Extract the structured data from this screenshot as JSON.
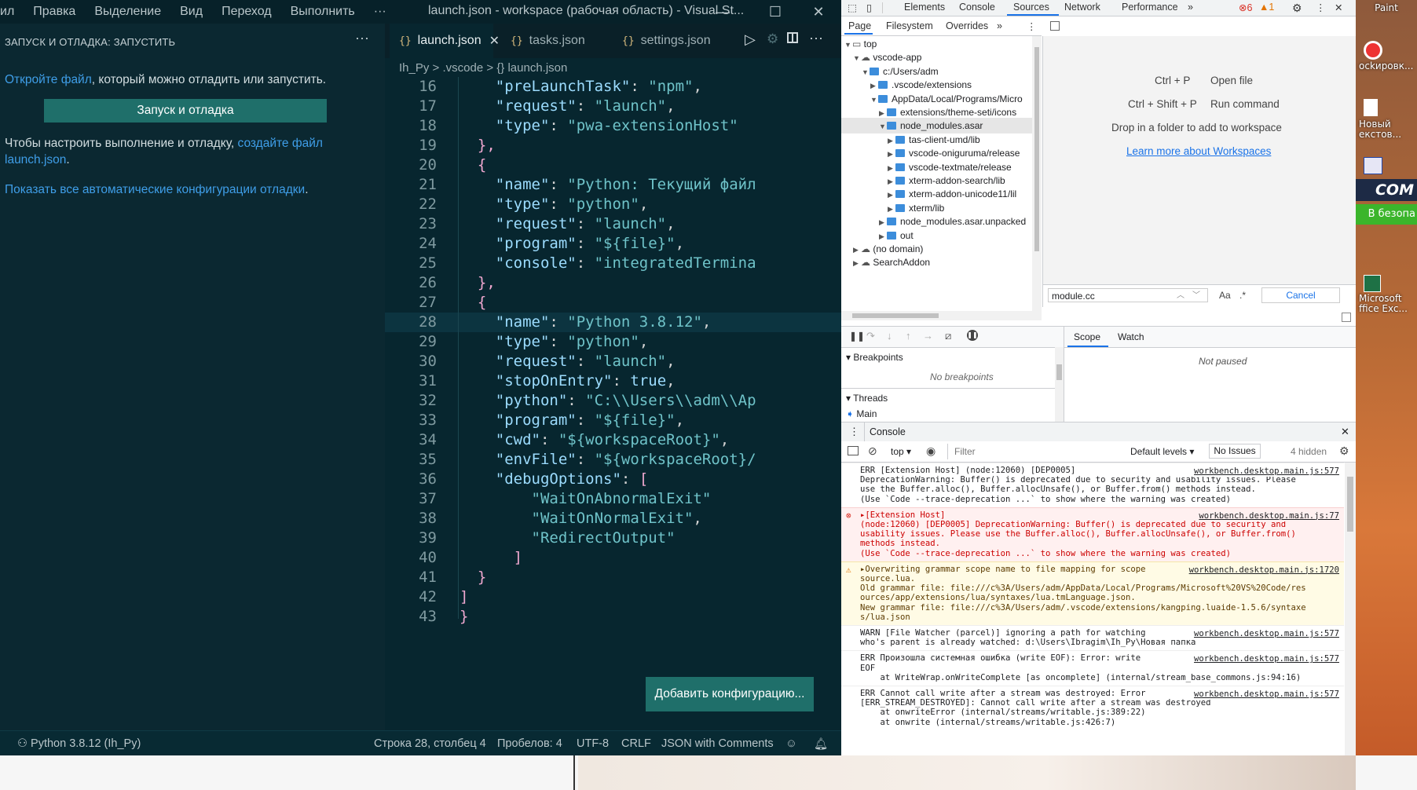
{
  "vscode": {
    "menu": [
      "ил",
      "Правка",
      "Выделение",
      "Вид",
      "Переход",
      "Выполнить",
      "···"
    ],
    "window_title": "launch.json - workspace (рабочая область) - Visual St...",
    "sidebar": {
      "title": "ЗАПУСК И ОТЛАДКА: ЗАПУСТИТЬ",
      "open_file_link": "Откройте файл",
      "open_file_text": ", который можно отладить или запустить.",
      "run_button": "Запуск и отладка",
      "configure_text": "Чтобы настроить выполнение и отладку, ",
      "configure_link": "создайте файл launch.json",
      "show_all_link": "Показать все автоматические конфигурации отладки",
      "period": "."
    },
    "tabs": [
      {
        "label": "launch.json",
        "active": true
      },
      {
        "label": "tasks.json",
        "active": false
      },
      {
        "label": "settings.json",
        "active": false
      }
    ],
    "breadcrumb": [
      "Ih_Py",
      ">",
      ".vscode",
      ">",
      "{} launch.json"
    ],
    "code_lines": [
      {
        "n": "16",
        "indent": "    ",
        "key": "\"preLaunchTask\"",
        "sep": ": ",
        "val": "\"npm\"",
        "tail": ","
      },
      {
        "n": "17",
        "indent": "    ",
        "key": "\"request\"",
        "sep": ": ",
        "val": "\"launch\"",
        "tail": ","
      },
      {
        "n": "18",
        "indent": "    ",
        "key": "\"type\"",
        "sep": ": ",
        "val": "\"pwa-extensionHost\"",
        "tail": ""
      },
      {
        "n": "19",
        "indent": "  ",
        "key": "",
        "sep": "",
        "val": "",
        "tail": "},"
      },
      {
        "n": "20",
        "indent": "  ",
        "key": "",
        "sep": "",
        "val": "",
        "tail": "{"
      },
      {
        "n": "21",
        "indent": "    ",
        "key": "\"name\"",
        "sep": ": ",
        "val": "\"Python: Текущий файл",
        "tail": ""
      },
      {
        "n": "22",
        "indent": "    ",
        "key": "\"type\"",
        "sep": ": ",
        "val": "\"python\"",
        "tail": ","
      },
      {
        "n": "23",
        "indent": "    ",
        "key": "\"request\"",
        "sep": ": ",
        "val": "\"launch\"",
        "tail": ","
      },
      {
        "n": "24",
        "indent": "    ",
        "key": "\"program\"",
        "sep": ": ",
        "val": "\"${file}\"",
        "tail": ","
      },
      {
        "n": "25",
        "indent": "    ",
        "key": "\"console\"",
        "sep": ": ",
        "val": "\"integratedTermina",
        "tail": ""
      },
      {
        "n": "26",
        "indent": "  ",
        "key": "",
        "sep": "",
        "val": "",
        "tail": "},"
      },
      {
        "n": "27",
        "indent": "  ",
        "key": "",
        "sep": "",
        "val": "",
        "tail": "{"
      },
      {
        "n": "28",
        "indent": "    ",
        "key": "\"name\"",
        "sep": ": ",
        "val": "\"Python 3.8.12\"",
        "tail": ","
      },
      {
        "n": "29",
        "indent": "    ",
        "key": "\"type\"",
        "sep": ": ",
        "val": "\"python\"",
        "tail": ","
      },
      {
        "n": "30",
        "indent": "    ",
        "key": "\"request\"",
        "sep": ": ",
        "val": "\"launch\"",
        "tail": ","
      },
      {
        "n": "31",
        "indent": "    ",
        "key": "\"stopOnEntry\"",
        "sep": ": ",
        "val": "true",
        "tail": ","
      },
      {
        "n": "32",
        "indent": "    ",
        "key": "\"python\"",
        "sep": ": ",
        "val": "\"C:\\\\Users\\\\adm\\\\Ap",
        "tail": ""
      },
      {
        "n": "33",
        "indent": "    ",
        "key": "\"program\"",
        "sep": ": ",
        "val": "\"${file}\"",
        "tail": ","
      },
      {
        "n": "34",
        "indent": "    ",
        "key": "\"cwd\"",
        "sep": ": ",
        "val": "\"${workspaceRoot}\"",
        "tail": ","
      },
      {
        "n": "35",
        "indent": "    ",
        "key": "\"envFile\"",
        "sep": ": ",
        "val": "\"${workspaceRoot}/",
        "tail": ""
      },
      {
        "n": "36",
        "indent": "    ",
        "key": "\"debugOptions\"",
        "sep": ": ",
        "val": "",
        "tail": "["
      },
      {
        "n": "37",
        "indent": "        ",
        "key": "",
        "sep": "",
        "val": "\"WaitOnAbnormalExit\"",
        "tail": ""
      },
      {
        "n": "38",
        "indent": "        ",
        "key": "",
        "sep": "",
        "val": "\"WaitOnNormalExit\"",
        "tail": ","
      },
      {
        "n": "39",
        "indent": "        ",
        "key": "",
        "sep": "",
        "val": "\"RedirectOutput\"",
        "tail": ""
      },
      {
        "n": "40",
        "indent": "      ",
        "key": "",
        "sep": "",
        "val": "",
        "tail": "]"
      },
      {
        "n": "41",
        "indent": "  ",
        "key": "",
        "sep": "",
        "val": "",
        "tail": "}"
      },
      {
        "n": "42",
        "indent": "",
        "key": "",
        "sep": "",
        "val": "",
        "tail": "]"
      },
      {
        "n": "43",
        "indent": "",
        "key": "",
        "sep": "",
        "val": "",
        "tail": "}"
      }
    ],
    "highlight_line": "28",
    "add_config_button": "Добавить конфигурацию...",
    "status": {
      "interpreter": "Python 3.8.12 (Ih_Py)",
      "position": "Строка 28, столбец 4",
      "spaces": "Пробелов: 4",
      "encoding": "UTF-8",
      "eol": "CRLF",
      "language": "JSON with Comments"
    }
  },
  "devtools": {
    "tabs": [
      "Elements",
      "Console",
      "Sources",
      "Network",
      "Performance",
      "»"
    ],
    "active_tab": "Sources",
    "errors": "6",
    "warnings": "1",
    "subtabs": [
      "Page",
      "Filesystem",
      "Overrides",
      "»"
    ],
    "tree": [
      {
        "label": "top",
        "depth": 0,
        "kind": "frame",
        "open": true
      },
      {
        "label": "vscode-app",
        "depth": 1,
        "kind": "cloud",
        "open": true
      },
      {
        "label": "c:/Users/adm",
        "depth": 2,
        "kind": "folder",
        "open": true
      },
      {
        "label": ".vscode/extensions",
        "depth": 3,
        "kind": "folder",
        "open": false
      },
      {
        "label": "AppData/Local/Programs/Micro",
        "depth": 3,
        "kind": "folder",
        "open": true
      },
      {
        "label": "extensions/theme-seti/icons",
        "depth": 4,
        "kind": "folder",
        "open": false
      },
      {
        "label": "node_modules.asar",
        "depth": 4,
        "kind": "folder",
        "open": true
      },
      {
        "label": "tas-client-umd/lib",
        "depth": 5,
        "kind": "folder",
        "open": false
      },
      {
        "label": "vscode-oniguruma/release",
        "depth": 5,
        "kind": "folder",
        "open": false
      },
      {
        "label": "vscode-textmate/release",
        "depth": 5,
        "kind": "folder",
        "open": false
      },
      {
        "label": "xterm-addon-search/lib",
        "depth": 5,
        "kind": "folder",
        "open": false
      },
      {
        "label": "xterm-addon-unicode11/lil",
        "depth": 5,
        "kind": "folder",
        "open": false
      },
      {
        "label": "xterm/lib",
        "depth": 5,
        "kind": "folder",
        "open": false
      },
      {
        "label": "node_modules.asar.unpacked",
        "depth": 4,
        "kind": "folder",
        "open": false
      },
      {
        "label": "out",
        "depth": 4,
        "kind": "folder",
        "open": false
      },
      {
        "label": "(no domain)",
        "depth": 1,
        "kind": "cloud",
        "open": false
      },
      {
        "label": "SearchAddon",
        "depth": 1,
        "kind": "cloud",
        "open": false
      }
    ],
    "shortcuts": [
      {
        "keys": "Ctrl + P",
        "action": "Open file"
      },
      {
        "keys": "Ctrl + Shift + P",
        "action": "Run command"
      }
    ],
    "drop_text": "Drop in a folder to add to workspace",
    "learn_link": "Learn more about Workspaces",
    "search_value": "module.cc",
    "match_case": "Aa",
    "regex": ".*",
    "cancel": "Cancel",
    "scope_tab": "Scope",
    "watch_tab": "Watch",
    "not_paused": "Not paused",
    "breakpoints_header": "Breakpoints",
    "no_breakpoints": "No breakpoints",
    "threads_header": "Threads",
    "main_thread": "Main",
    "console_title": "Console",
    "context": "top",
    "filter_placeholder": "Filter",
    "levels": "Default levels",
    "issues": "No Issues",
    "hidden": "4 hidden",
    "messages": [
      {
        "type": "info",
        "source": "workbench.desktop.main.js:577",
        "text": "ERR [Extension Host] (node:12060) [DEP0005]\nDeprecationWarning: Buffer() is deprecated due to security and usability issues. Please\nuse the Buffer.alloc(), Buffer.allocUnsafe(), or Buffer.from() methods instead.\n(Use `Code --trace-deprecation ...` to show where the warning was created)"
      },
      {
        "type": "err",
        "source": "workbench.desktop.main.js:77",
        "text": "▸[Extension Host]\n(node:12060) [DEP0005] DeprecationWarning: Buffer() is deprecated due to security and\nusability issues. Please use the Buffer.alloc(), Buffer.allocUnsafe(), or Buffer.from()\nmethods instead.\n(Use `Code --trace-deprecation ...` to show where the warning was created)"
      },
      {
        "type": "warn",
        "source": "workbench.desktop.main.js:1720",
        "text": "▸Overwriting grammar scope name to file mapping for scope\nsource.lua.\nOld grammar file: file:///c%3A/Users/adm/AppData/Local/Programs/Microsoft%20VS%20Code/res\nources/app/extensions/lua/syntaxes/lua.tmLanguage.json.\nNew grammar file: file:///c%3A/Users/adm/.vscode/extensions/kangping.luaide-1.5.6/syntaxe\ns/lua.json"
      },
      {
        "type": "info",
        "source": "workbench.desktop.main.js:577",
        "text": "WARN [File Watcher (parcel)] ignoring a path for watching\nwho's parent is already watched: d:\\Users\\Ibragim\\Ih_Py\\Новая папка"
      },
      {
        "type": "info",
        "source": "workbench.desktop.main.js:577",
        "text": "ERR Произошла системная ошибка (write EOF): Error: write\nEOF\n    at WriteWrap.onWriteComplete [as oncomplete] (internal/stream_base_commons.js:94:16)"
      },
      {
        "type": "info",
        "source": "workbench.desktop.main.js:577",
        "text": "ERR Cannot call write after a stream was destroyed: Error\n[ERR_STREAM_DESTROYED]: Cannot call write after a stream was destroyed\n    at onwriteError (internal/streams/writable.js:389:22)\n    at onwrite (internal/streams/writable.js:426:7)"
      }
    ]
  },
  "desktop": {
    "icons": [
      "Paint",
      "ockировк...",
      "Новый\nекстов...",
      "COM",
      "В безопа",
      "Microsoft\nffice Exc..."
    ]
  },
  "colors": {
    "vscode_bg": "#082a33",
    "accent_button": "#1f6f6a",
    "link": "#3f9ee8",
    "json_key": "#9cdcfe",
    "json_string": "#6fc3c9"
  }
}
